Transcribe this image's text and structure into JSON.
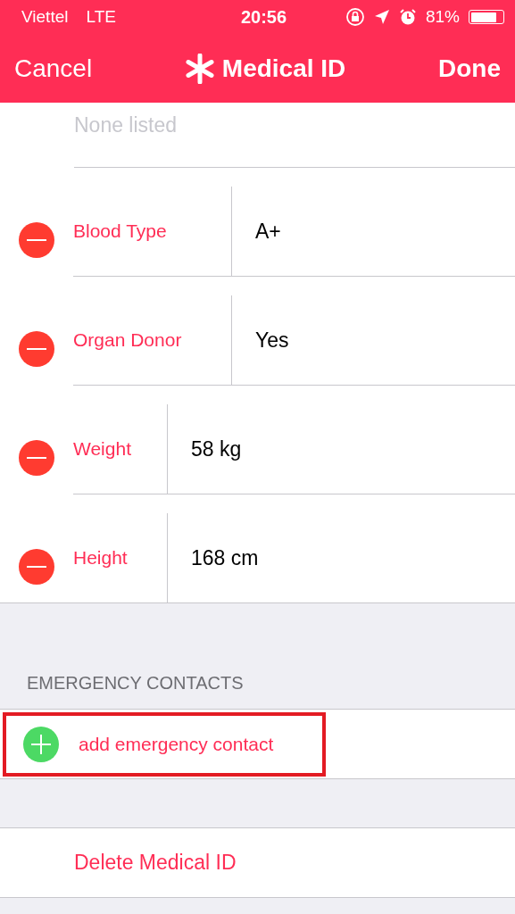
{
  "status_bar": {
    "carrier": "Viettel",
    "network": "LTE",
    "time": "20:56",
    "battery": "81%"
  },
  "nav_bar": {
    "cancel": "Cancel",
    "title": "Medical ID",
    "done": "Done"
  },
  "previous_field": {
    "placeholder": "None listed"
  },
  "fields": [
    {
      "label": "Blood Type",
      "value": "A+",
      "wide": true
    },
    {
      "label": "Organ Donor",
      "value": "Yes",
      "wide": true
    },
    {
      "label": "Weight",
      "value": "58 kg",
      "wide": false
    },
    {
      "label": "Height",
      "value": "168 cm",
      "wide": false
    }
  ],
  "emergency_contacts": {
    "header": "EMERGENCY CONTACTS",
    "add": "add emergency contact",
    "highlighted": true
  },
  "delete": "Delete Medical ID"
}
